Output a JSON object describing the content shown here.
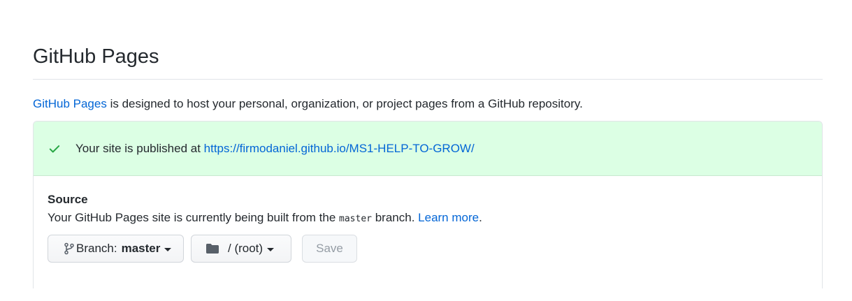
{
  "header": {
    "title": "GitHub Pages"
  },
  "intro": {
    "link_text": "GitHub Pages",
    "text": " is designed to host your personal, organization, or project pages from a GitHub repository."
  },
  "flash": {
    "icon": "check-icon",
    "prefix": "Your site is published at ",
    "url": "https://firmodaniel.github.io/MS1-HELP-TO-GROW/",
    "background_color": "#dcffe4",
    "icon_color": "#28a745"
  },
  "source": {
    "heading": "Source",
    "desc_before": "Your GitHub Pages site is currently being built from the ",
    "branch_code": "master",
    "desc_after": " branch. ",
    "learn_more": "Learn more",
    "desc_end": "."
  },
  "controls": {
    "branch_icon": "git-branch-icon",
    "branch_label": "Branch:",
    "branch_value": "master",
    "folder_icon": "folder-icon",
    "folder_value": "/ (root)",
    "save_label": "Save"
  },
  "colors": {
    "link": "#0366d6",
    "text": "#24292e",
    "border": "#e1e4e8"
  }
}
